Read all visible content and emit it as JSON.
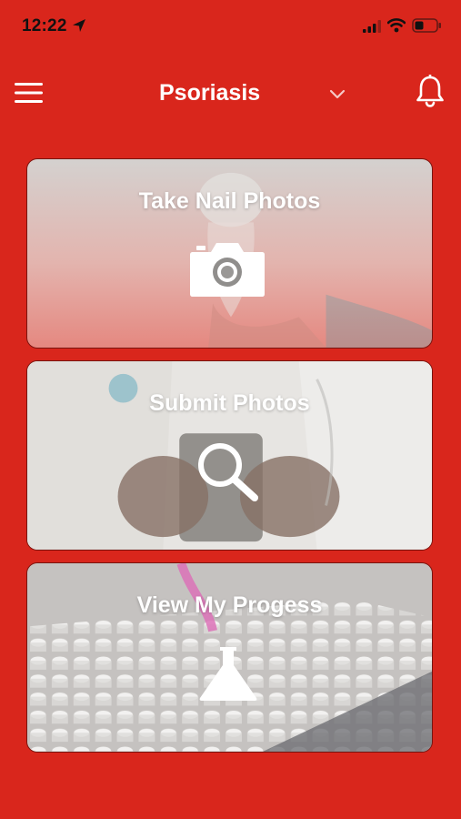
{
  "status_bar": {
    "time": "12:22",
    "icons": [
      "location-arrow-icon",
      "signal-icon",
      "wifi-icon",
      "battery-icon"
    ]
  },
  "header": {
    "title": "Psoriasis",
    "menu_icon": "hamburger-menu-icon",
    "dropdown_icon": "chevron-down-icon",
    "notification_icon": "bell-icon"
  },
  "cards": [
    {
      "label": "Take Nail Photos",
      "icon": "camera-icon"
    },
    {
      "label": "Submit Photos",
      "icon": "search-icon"
    },
    {
      "label": "View My Progess",
      "icon": "flask-icon"
    }
  ],
  "colors": {
    "accent": "#d9261c",
    "card_overlay": "#e8e4e2"
  }
}
